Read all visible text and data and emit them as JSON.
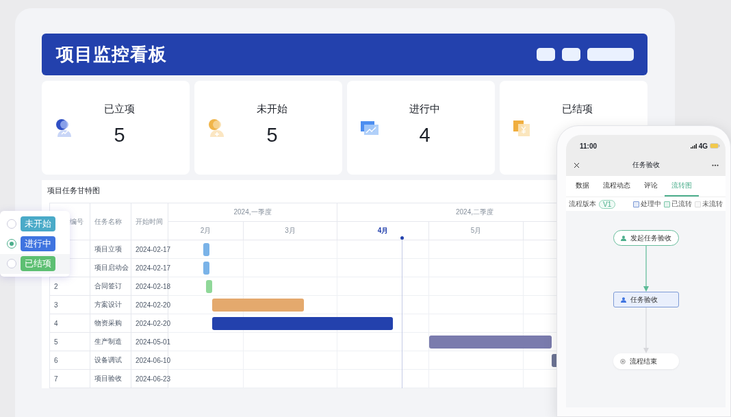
{
  "header": {
    "title": "项目监控看板"
  },
  "stats": [
    {
      "label": "已立项",
      "value": "5"
    },
    {
      "label": "未开始",
      "value": "5"
    },
    {
      "label": "进行中",
      "value": "4"
    },
    {
      "label": "已结项"
    }
  ],
  "gantt": {
    "title": "项目任务甘特图",
    "columns": [
      "编号",
      "任务名称",
      "开始时间"
    ],
    "quarters": [
      "2024,一季度",
      "2024,二季度"
    ],
    "months": [
      {
        "label": "2月",
        "current": false
      },
      {
        "label": "3月",
        "current": false
      },
      {
        "label": "4月",
        "current": true
      },
      {
        "label": "5月",
        "current": false
      }
    ],
    "rows": [
      {
        "name": "项目立项",
        "start": "2024-02-17",
        "color": "#7ab3e8"
      },
      {
        "name": "项目启动会",
        "start": "2024-02-17",
        "color": "#7ab3e8"
      },
      {
        "id": "2",
        "name": "合同签订",
        "start": "2024-02-18",
        "color": "#90d899"
      },
      {
        "id": "3",
        "name": "方案设计",
        "start": "2024-02-20",
        "color": "#e4a96d"
      },
      {
        "id": "4",
        "name": "物资采购",
        "start": "2024-02-20",
        "color": "#2341ad"
      },
      {
        "id": "5",
        "name": "生产制造",
        "start": "2024-05-01",
        "color": "#7a7bad"
      },
      {
        "id": "6",
        "name": "设备调试",
        "start": "2024-06-10",
        "color": "#6d7596"
      },
      {
        "id": "7",
        "name": "项目验收",
        "start": "2024-06-23"
      }
    ]
  },
  "status_filter": [
    {
      "label": "未开始",
      "color": "#4aaac8",
      "selected": false
    },
    {
      "label": "进行中",
      "color": "#3f74e0",
      "selected": true
    },
    {
      "label": "已结项",
      "color": "#5dbf72",
      "selected": false
    }
  ],
  "phone": {
    "time": "11:00",
    "network": "4G",
    "title": "任务验收",
    "tabs": [
      {
        "label": "数据",
        "selected": false
      },
      {
        "label": "流程动态",
        "selected": false
      },
      {
        "label": "评论",
        "selected": false
      },
      {
        "label": "流转图",
        "selected": true
      }
    ],
    "version_label": "流程版本",
    "version": "V1",
    "legend": [
      {
        "label": "处理中",
        "color": "#7e9bd6"
      },
      {
        "label": "已流转",
        "color": "#7cc7aa"
      },
      {
        "label": "未流转",
        "color": "#dddddd"
      }
    ],
    "flow": [
      {
        "label": "发起任务验收",
        "kind": "start"
      },
      {
        "label": "任务验收",
        "kind": "task"
      },
      {
        "label": "流程结束",
        "kind": "end"
      }
    ]
  }
}
